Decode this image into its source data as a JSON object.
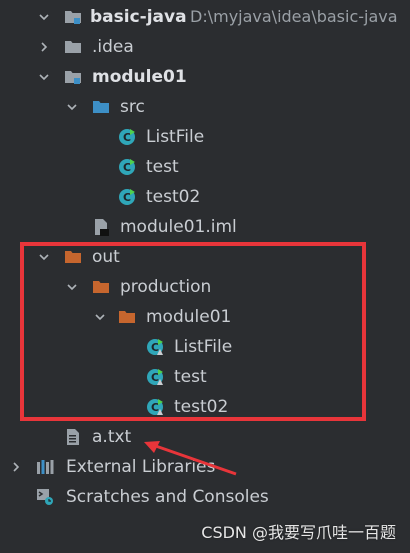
{
  "tree": {
    "project_root": {
      "name": "basic-java",
      "path": "D:\\myjava\\idea\\basic-java"
    },
    "idea_folder": {
      "name": ".idea"
    },
    "module": {
      "name": "module01"
    },
    "src_folder": {
      "name": "src"
    },
    "src_files": [
      {
        "name": "ListFile"
      },
      {
        "name": "test"
      },
      {
        "name": "test02"
      }
    ],
    "iml_file": {
      "name": "module01.iml"
    },
    "out_folder": {
      "name": "out"
    },
    "production_folder": {
      "name": "production"
    },
    "out_module_folder": {
      "name": "module01"
    },
    "compiled_files": [
      {
        "name": "ListFile"
      },
      {
        "name": "test"
      },
      {
        "name": "test02"
      }
    ],
    "txt_file": {
      "name": "a.txt"
    },
    "external_libraries": {
      "name": "External Libraries"
    },
    "scratches": {
      "name": "Scratches and Consoles"
    }
  },
  "watermark": "CSDN @我要写爪哇一百题",
  "colors": {
    "background": "#2b2d30",
    "text": "#c9cdd2",
    "folder_gray": "#9aa1a8",
    "folder_blue": "#3d8fc6",
    "folder_orange": "#c6662e",
    "class_cyan": "#2fa6b8",
    "highlight_red": "#e8353a"
  }
}
